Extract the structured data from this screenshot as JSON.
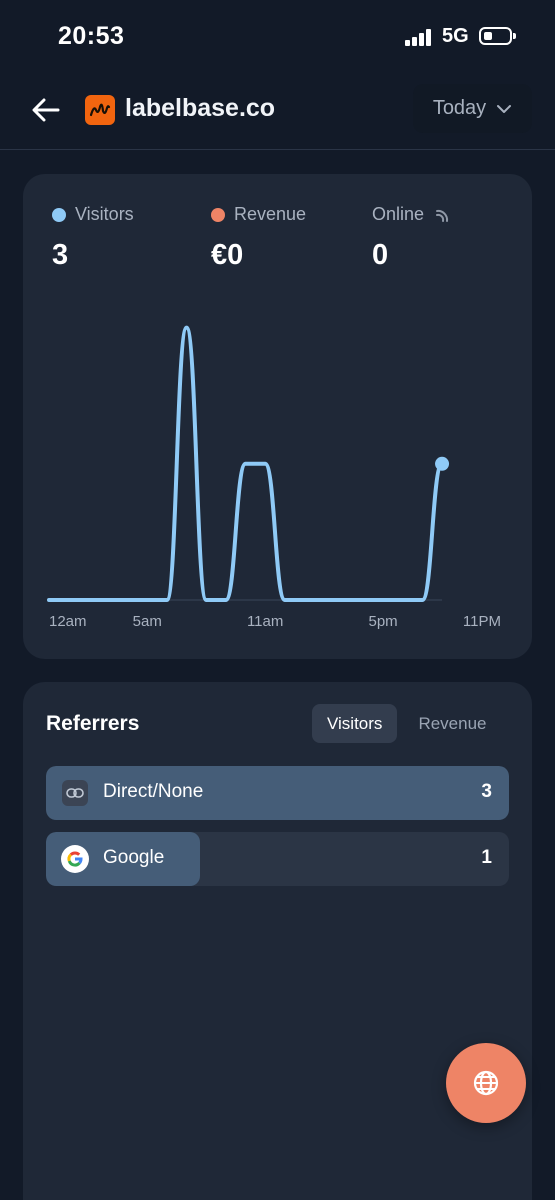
{
  "status_bar": {
    "time": "20:53",
    "network": "5G"
  },
  "header": {
    "site_name": "labelbase.co",
    "period": "Today"
  },
  "metrics": [
    {
      "label": "Visitors",
      "value": "3",
      "color": "#8fcaf6"
    },
    {
      "label": "Revenue",
      "value": "€0",
      "color": "#ee8466"
    },
    {
      "label": "Online",
      "value": "0"
    }
  ],
  "chart_data": {
    "type": "line",
    "x_ticks": [
      "12am",
      "5am",
      "11am",
      "5pm",
      "11PM"
    ],
    "x_hours": [
      0,
      1,
      2,
      3,
      4,
      5,
      6,
      7,
      8,
      9,
      10,
      11,
      12,
      13,
      14,
      15,
      16,
      17,
      18,
      19,
      20
    ],
    "series": [
      {
        "values": [
          0,
          0,
          0,
          0,
          0,
          0,
          0,
          2,
          0,
          0,
          1,
          1,
          0,
          0,
          0,
          0,
          0,
          0,
          0,
          0,
          1
        ]
      }
    ],
    "ylim": [
      0,
      2.1
    ],
    "xlim": [
      0,
      23
    ],
    "grid": false,
    "color": "#8fcaf6"
  },
  "referrers": {
    "title": "Referrers",
    "tabs": [
      "Visitors",
      "Revenue"
    ],
    "active_tab": "Visitors",
    "rows": [
      {
        "name": "Direct/None",
        "count": "3",
        "share": 1.0
      },
      {
        "name": "Google",
        "count": "1",
        "share": 0.333
      }
    ]
  },
  "icons": {
    "back": "back-arrow-icon",
    "online": "realtime-signal-icon",
    "direct": "link-icon",
    "google": "google-logo-icon",
    "fab": "globe-icon"
  }
}
